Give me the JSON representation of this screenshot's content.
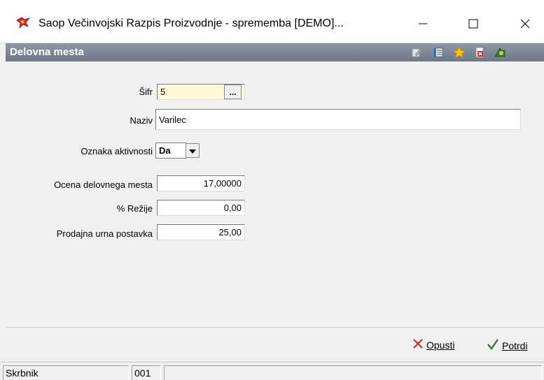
{
  "window": {
    "title": "Saop Večinvojski Razpis Proizvodnje - sprememba [DEMO]...",
    "minimize": "—",
    "maximize": "☐",
    "close": "✕"
  },
  "header": {
    "title": "Delovna mesta",
    "icons": [
      "edit-icon",
      "list-icon",
      "star-icon",
      "close-doc-icon",
      "exit-icon"
    ]
  },
  "form": {
    "sifra": {
      "label": "Šifr",
      "value": "5",
      "button": "..."
    },
    "naziv": {
      "label": "Naziv",
      "value": "Varilec"
    },
    "oznaka": {
      "label": "Oznaka aktivnosti",
      "value": "Da"
    },
    "ocena": {
      "label": "Ocena delovnega mesta",
      "value": "17,00000"
    },
    "rezije": {
      "label": "% Režije",
      "value": "0,00"
    },
    "postavka": {
      "label": "Prodajna urna postavka",
      "value": "25,00"
    }
  },
  "footer": {
    "cancel_label": "Opusti",
    "confirm_label": "Potrdi"
  },
  "status": {
    "user": "Skrbnik",
    "code": "001",
    "extra": ""
  },
  "colors": {
    "header_gradient_top": "#8d98a6",
    "header_gradient_bottom": "#6d7988",
    "key_field_bg": "#fff9d8",
    "cancel_red": "#c62828",
    "confirm_green": "#2e7d32"
  }
}
